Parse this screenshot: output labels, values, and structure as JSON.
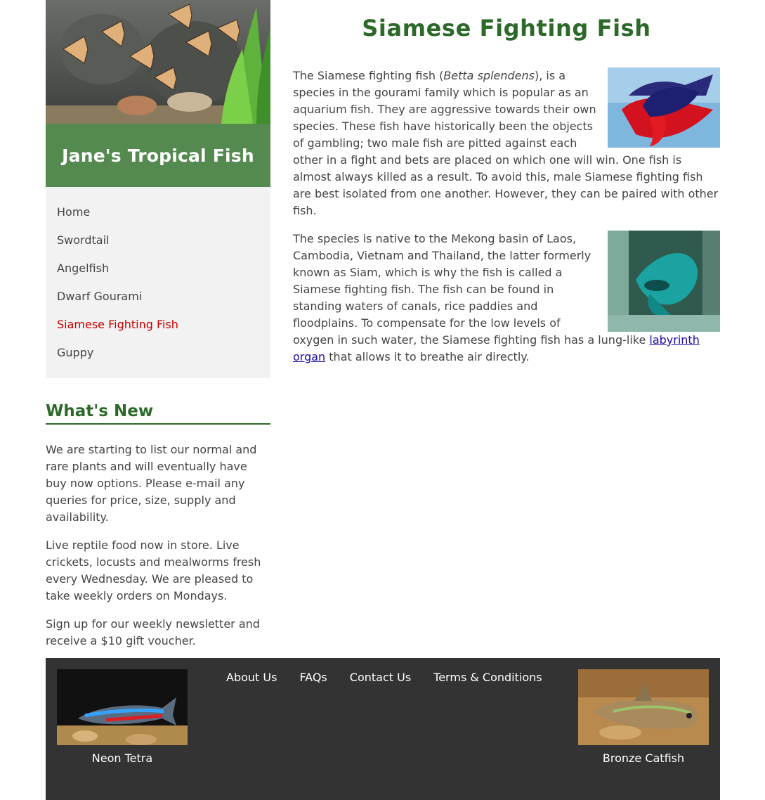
{
  "site": {
    "title": "Jane's Tropical Fish"
  },
  "nav": {
    "items": [
      {
        "label": "Home"
      },
      {
        "label": "Swordtail"
      },
      {
        "label": "Angelfish"
      },
      {
        "label": "Dwarf Gourami"
      },
      {
        "label": "Siamese Fighting Fish",
        "active": true
      },
      {
        "label": "Guppy"
      }
    ]
  },
  "whats_new": {
    "heading": "What's New",
    "paragraphs": [
      "We are starting to list our normal and rare plants and will eventually have buy now options. Please e-mail any queries for price, size, supply and availability.",
      "Live reptile food now in store. Live crickets, locusts and mealworms fresh every Wednesday. We are pleased to take weekly orders on Mondays.",
      "Sign up for our weekly newsletter and receive a $10 gift voucher."
    ]
  },
  "main": {
    "title": "Siamese Fighting Fish",
    "p1": {
      "before": "The Siamese fighting fish (",
      "italic": "Betta splendens",
      "after": "), is a species in the gourami family which is popular as an aquarium fish. They are aggressive towards their own species. These fish have historically been the objects of gambling; two male fish are pitted against each other in a fight and bets are placed on which one will win. One fish is almost always killed as a result. To avoid this, male Siamese fighting fish are best isolated from one another. However, they can be paired with other fish."
    },
    "p2": {
      "before": "The species is native to the Mekong basin of Laos, Cambodia, Vietnam and Thailand, the latter formerly known as Siam, which is why the fish is called a Siamese fighting fish. The fish can be found in standing waters of canals, rice paddies and floodplains. To compensate for the low levels of oxygen in such water, the Siamese fighting fish has a lung-like ",
      "link": "labyrinth organ",
      "after": " that allows it to breathe air directly."
    }
  },
  "footer": {
    "links": [
      {
        "label": "About Us"
      },
      {
        "label": "FAQs"
      },
      {
        "label": "Contact Us"
      },
      {
        "label": "Terms & Conditions"
      }
    ],
    "cards": [
      {
        "caption": "Neon Tetra"
      },
      {
        "caption": "Bronze Catfish"
      }
    ]
  },
  "colors": {
    "brand_green": "#548a4f",
    "heading_green": "#2d6a2a",
    "active_nav": "#cc0000",
    "footer_bg": "#333333"
  }
}
